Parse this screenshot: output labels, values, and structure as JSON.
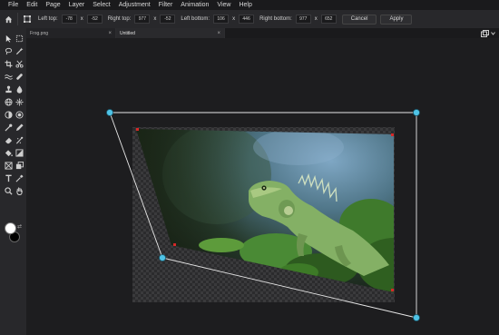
{
  "menu": [
    "File",
    "Edit",
    "Page",
    "Layer",
    "Select",
    "Adjustment",
    "Filter",
    "Animation",
    "View",
    "Help"
  ],
  "options": {
    "left_top": {
      "label": "Left top:",
      "x": "-78",
      "y": "-52"
    },
    "right_top": {
      "label": "Right top:",
      "x": "977",
      "y": "-52"
    },
    "left_bottom": {
      "label": "Left bottom:",
      "x": "106",
      "y": "446"
    },
    "right_bottom": {
      "label": "Right bottom:",
      "x": "977",
      "y": "652"
    },
    "sep": "x",
    "cancel_label": "Cancel",
    "apply_label": "Apply"
  },
  "tabs": [
    {
      "label": "Frog.png",
      "close": "×"
    },
    {
      "label": "Untitled",
      "close": "×"
    }
  ],
  "tools": [
    "pointer-icon",
    "marquee-icon",
    "lasso-icon",
    "magic-wand-icon",
    "crop-icon",
    "scissors-icon",
    "wave-icon",
    "healing-icon",
    "stamp-icon",
    "drop-icon",
    "globe-icon",
    "brush-sparkle-icon",
    "contrast-icon",
    "spot-icon",
    "picker-icon",
    "pencil-icon",
    "eraser-icon",
    "smudge-icon",
    "bucket-icon",
    "gradient-icon",
    "frame-icon",
    "clone-icon",
    "text-icon",
    "eyedropper-icon",
    "zoom-icon",
    "hand-icon"
  ],
  "colors": {
    "foreground": "#ffffff",
    "background": "#000000",
    "handle": "#4fc3e6"
  }
}
